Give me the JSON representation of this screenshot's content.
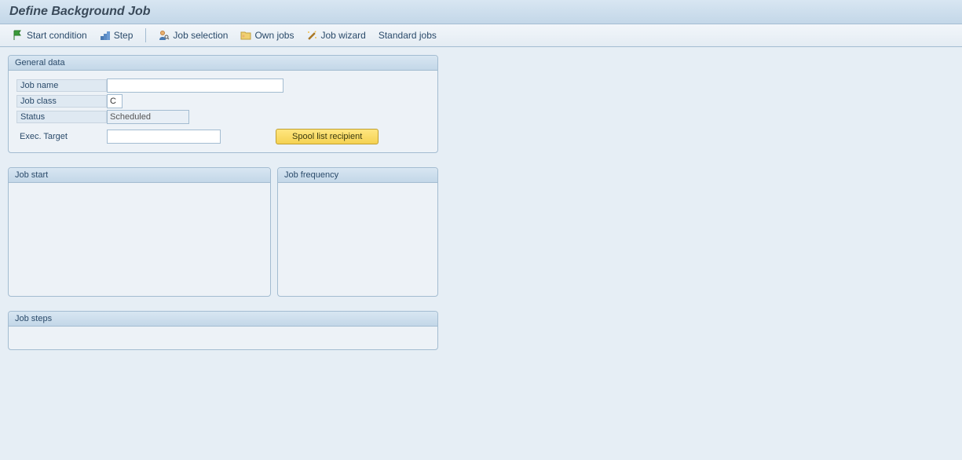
{
  "header": {
    "title": "Define Background Job"
  },
  "toolbar": {
    "start_condition": "Start condition",
    "step": "Step",
    "job_selection": "Job selection",
    "own_jobs": "Own jobs",
    "job_wizard": "Job wizard",
    "standard_jobs": "Standard jobs"
  },
  "general_data": {
    "title": "General data",
    "job_name_label": "Job name",
    "job_name_value": "",
    "job_class_label": "Job class",
    "job_class_value": "C",
    "status_label": "Status",
    "status_value": "Scheduled",
    "exec_target_label": "Exec. Target",
    "exec_target_value": "",
    "spool_button": "Spool list recipient"
  },
  "job_start": {
    "title": "Job start"
  },
  "job_frequency": {
    "title": "Job frequency"
  },
  "job_steps": {
    "title": "Job steps"
  }
}
